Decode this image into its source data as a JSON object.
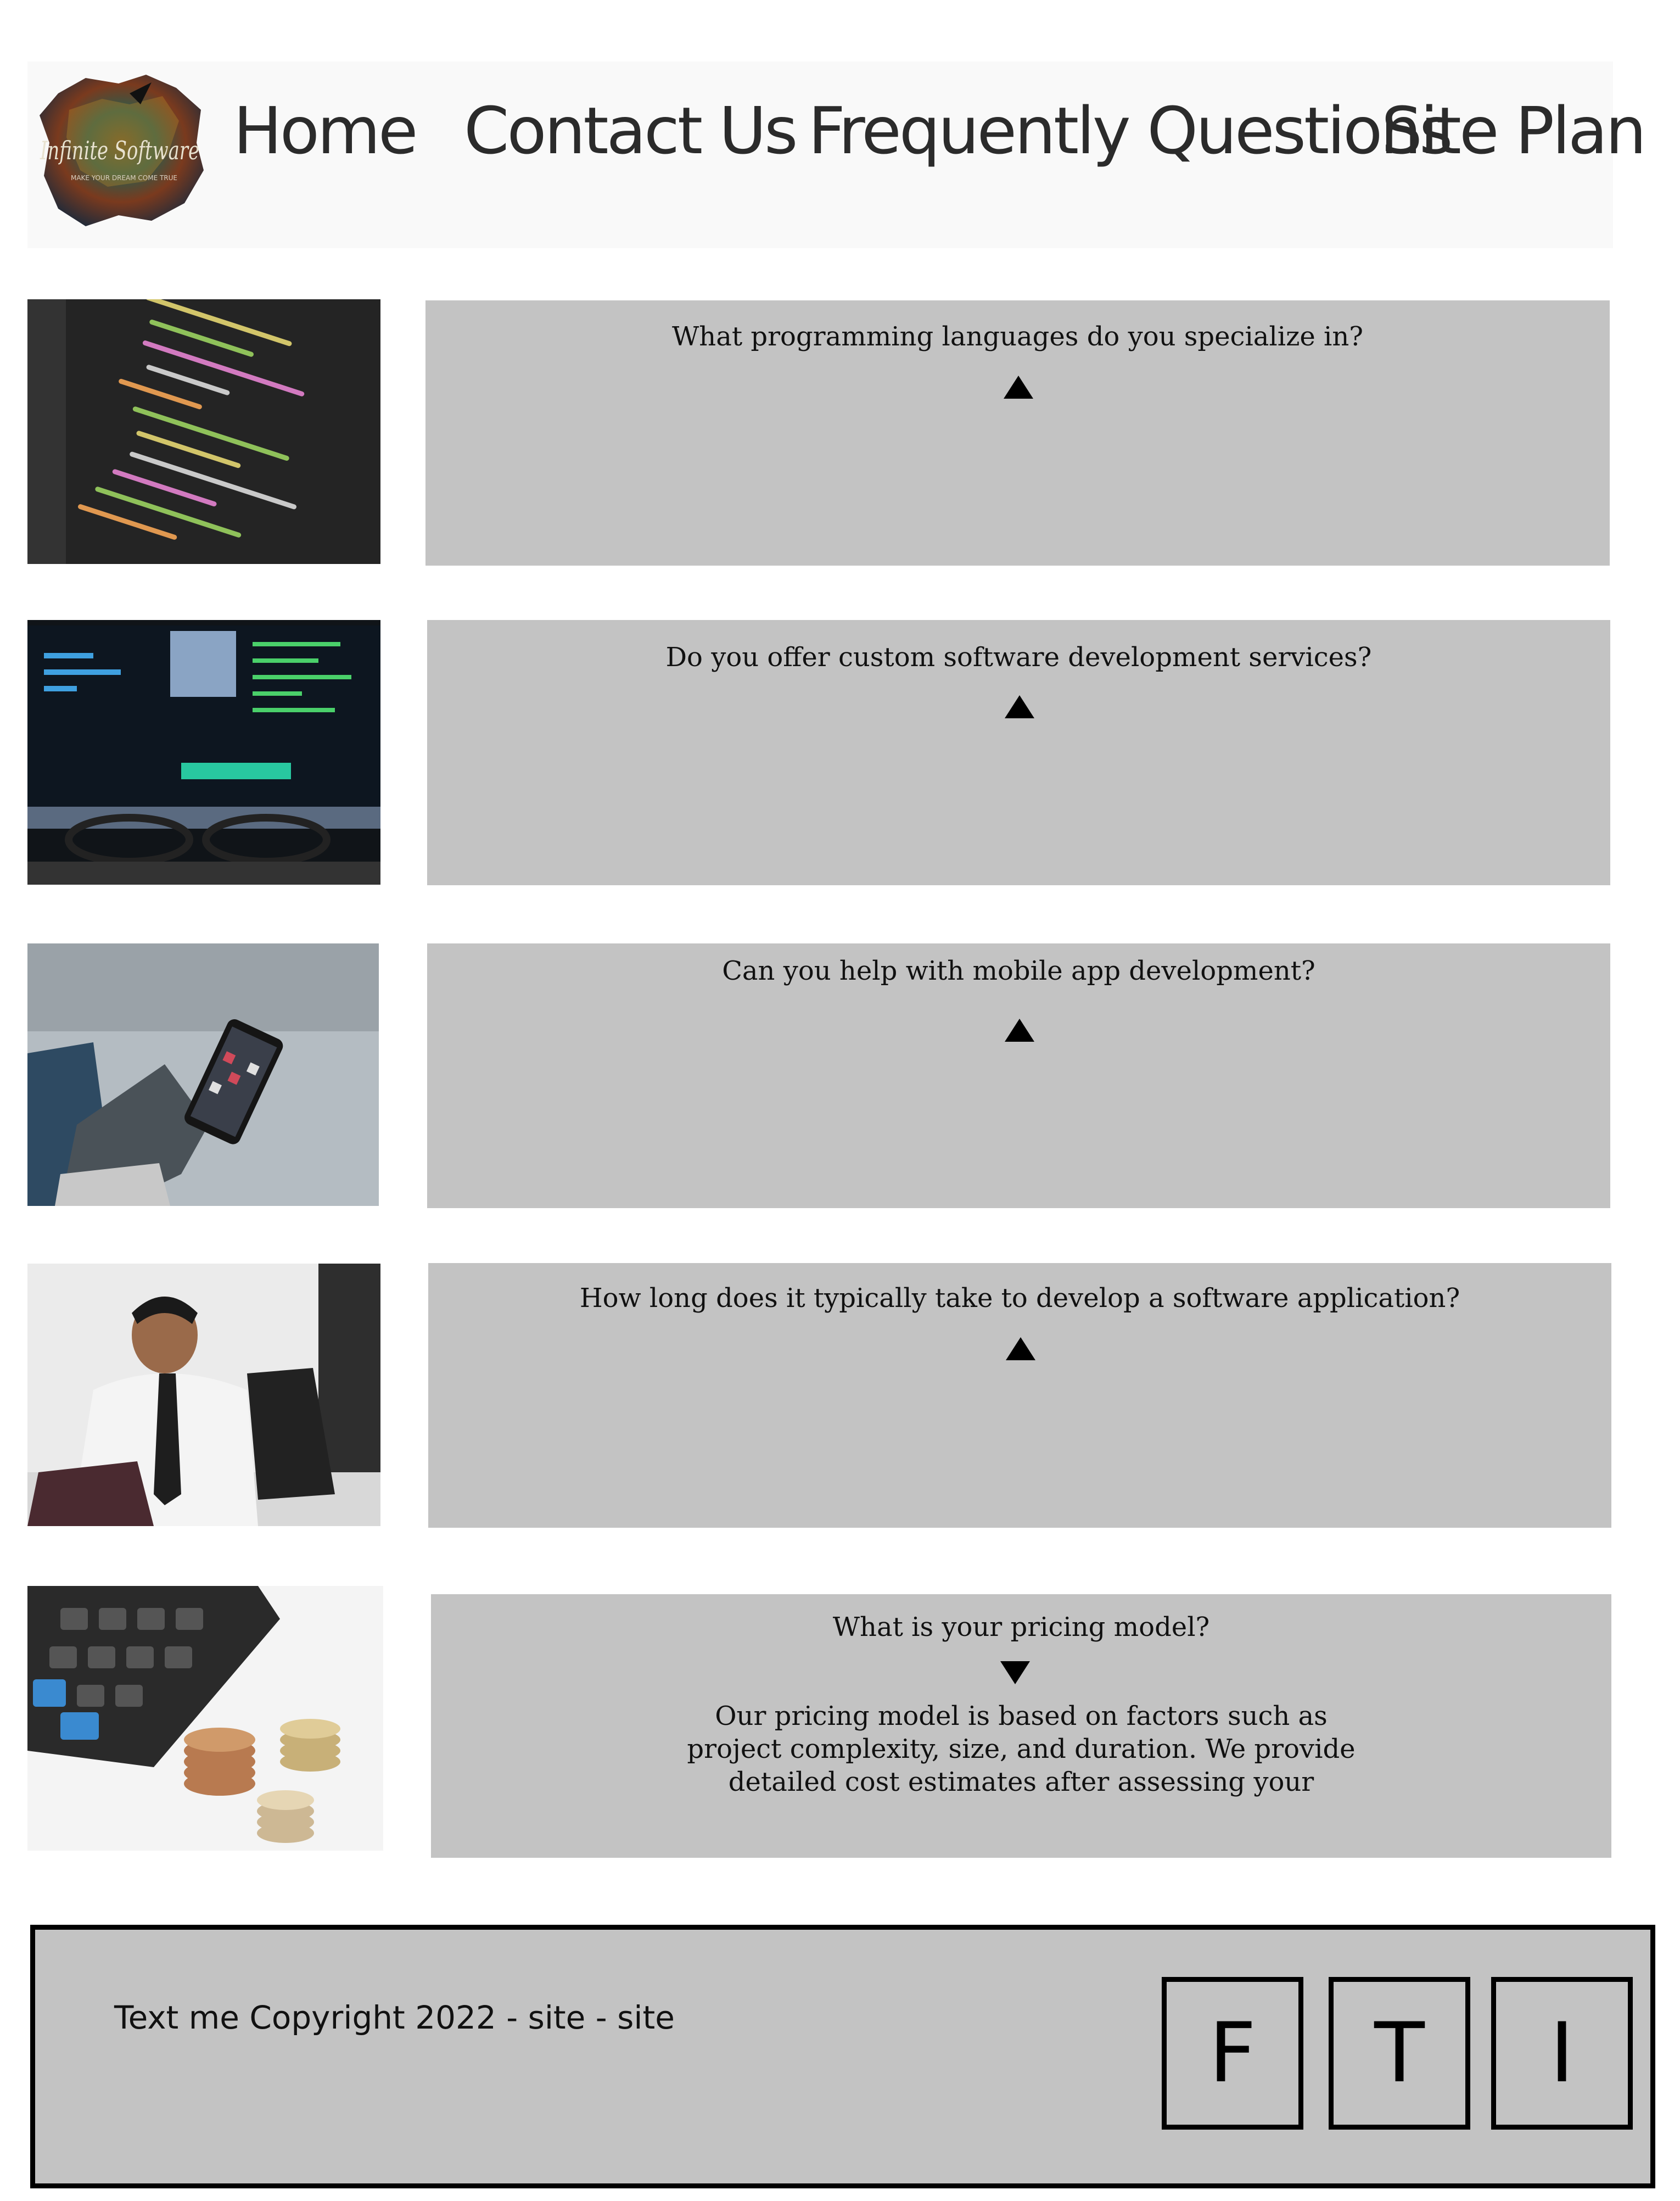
{
  "header": {
    "logo": {
      "name": "Infinite Software",
      "tagline": "MAKE YOUR DREAM COME TRUE"
    },
    "nav": [
      {
        "label": "Home"
      },
      {
        "label": "Contact Us"
      },
      {
        "label": "Frequently Questions"
      },
      {
        "label": "Site Plan"
      }
    ]
  },
  "faq": [
    {
      "image": "code-editor-photo",
      "question": "What programming languages do you specialize in?",
      "expanded": false
    },
    {
      "image": "monitor-glasses-photo",
      "question": "Do you offer custom software development services?",
      "expanded": false
    },
    {
      "image": "phone-in-gloved-hand-photo",
      "question": "Can you help with mobile app development?",
      "expanded": false
    },
    {
      "image": "businessman-checking-watch-photo",
      "question": "How long does it typically take to develop a software application?",
      "expanded": false
    },
    {
      "image": "calculator-coins-photo",
      "question": "What is your pricing model?",
      "expanded": true,
      "answer_lines": [
        "Our pricing model is based on factors such as",
        "project complexity, size, and duration. We provide",
        "detailed cost estimates after assessing your"
      ]
    }
  ],
  "footer": {
    "text": "Text me Copyright 2022 - site - site",
    "social": [
      {
        "label": "F"
      },
      {
        "label": "T"
      },
      {
        "label": "I"
      }
    ]
  },
  "colors": {
    "panel": "#c3c3c3",
    "header": "#f9f9f9",
    "text": "#111111"
  }
}
